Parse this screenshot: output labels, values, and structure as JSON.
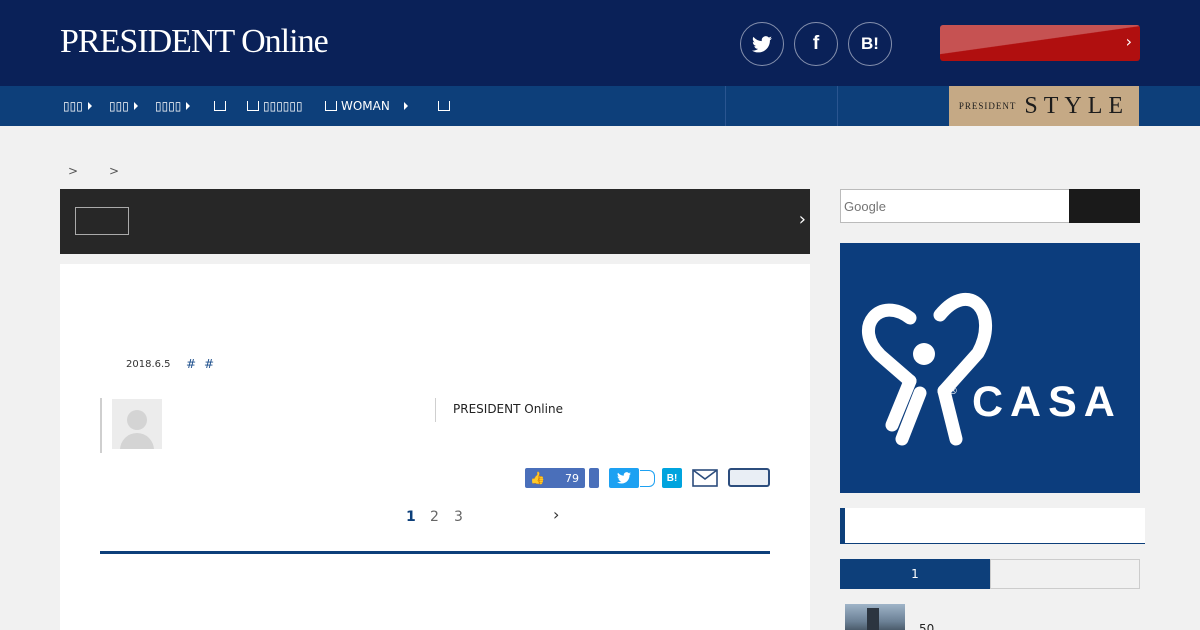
{
  "header": {
    "logo": "PRESIDENT Online",
    "social": {
      "twitter": "twitter-icon",
      "facebook": "f",
      "hatena": "B!"
    }
  },
  "nav": {
    "items": [
      {
        "label": "▯▯▯"
      },
      {
        "label": "▯▯▯"
      },
      {
        "label": "▯▯▯▯"
      },
      {
        "label": ""
      },
      {
        "label": "▯▯▯▯▯▯"
      },
      {
        "label": "WOMAN"
      },
      {
        "label": ""
      }
    ],
    "style_badge": {
      "small": "PRESIDENT",
      "big": "STYLE"
    }
  },
  "breadcrumb": {
    "sep1": ">",
    "sep2": ">"
  },
  "article": {
    "date": "2018.6.5",
    "tags": [
      "#",
      "#"
    ],
    "source": "PRESIDENT Online",
    "likes": "79"
  },
  "pagination": {
    "pages": [
      "1",
      "2",
      "3"
    ],
    "next": "›"
  },
  "sidebar": {
    "search_placeholder": "Google",
    "ad": {
      "brand": "CASA",
      "reg": "®"
    },
    "ranking": {
      "tab1": "1",
      "item1_text": "50"
    }
  },
  "colors": {
    "header_bg": "#0a2158",
    "nav_bg": "#0d3f7a",
    "accent_red": "#b00f0f",
    "style_gold": "#c5a985",
    "casa_blue": "#0c3d7d"
  }
}
